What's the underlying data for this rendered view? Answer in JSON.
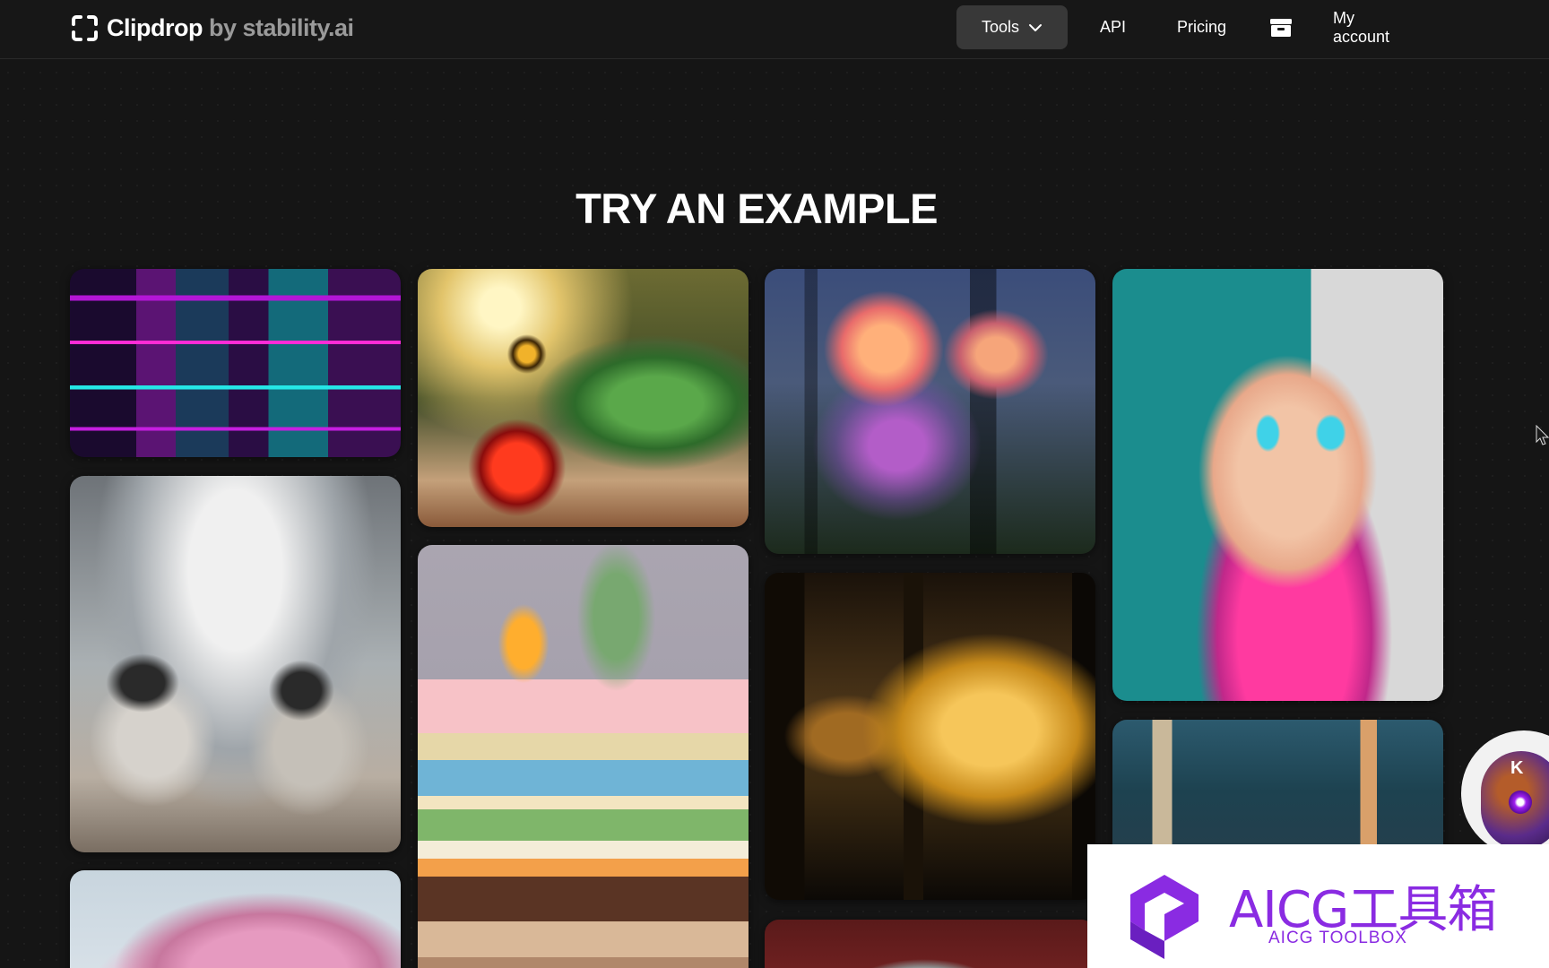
{
  "nav": {
    "brand": "Clipdrop",
    "brand_suffix": " by stability.ai",
    "tools_label": "Tools",
    "api_label": "API",
    "pricing_label": "Pricing",
    "archive_icon": "archive-icon",
    "account_label": "My account"
  },
  "main": {
    "section_title": "TRY AN EXAMPLE",
    "examples": [
      {
        "subject": "neon-building"
      },
      {
        "subject": "bee-and-jar"
      },
      {
        "subject": "jellyfish-forest"
      },
      {
        "subject": "dog-sunglasses"
      },
      {
        "subject": "cowboys-horses"
      },
      {
        "subject": "layer-cake"
      },
      {
        "subject": "train-window"
      },
      {
        "subject": "anime-street"
      },
      {
        "subject": "cherry-blossom"
      },
      {
        "subject": "portrait"
      }
    ]
  },
  "overlay": {
    "watermark_title": "AICG工具箱",
    "watermark_subtitle": "AICG TOOLBOX",
    "avatar_badge": "K"
  },
  "colors": {
    "background": "#151515",
    "nav_active_bg": "#383838",
    "watermark_accent": "#8a2be2"
  }
}
